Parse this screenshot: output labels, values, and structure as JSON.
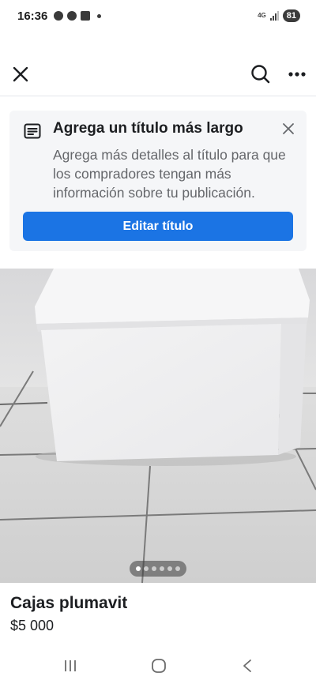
{
  "status_bar": {
    "time": "16:36",
    "network": "4G",
    "battery": "81"
  },
  "nav": {
    "close_icon": "close-icon",
    "search_icon": "search-icon",
    "more_icon": "more-horizontal-icon"
  },
  "banner": {
    "title": "Agrega un título más largo",
    "body": "Agrega más detalles al título para que los compradores tengan más información sobre tu publicación.",
    "button_label": "Editar título",
    "accent_color": "#1b74e4"
  },
  "photo": {
    "pager_total": 6,
    "pager_active": 1
  },
  "listing": {
    "title": "Cajas plumavit",
    "price": "$5 000"
  },
  "system_nav": {
    "recents_icon": "recents-icon",
    "home_icon": "home-icon",
    "back_icon": "back-icon"
  }
}
